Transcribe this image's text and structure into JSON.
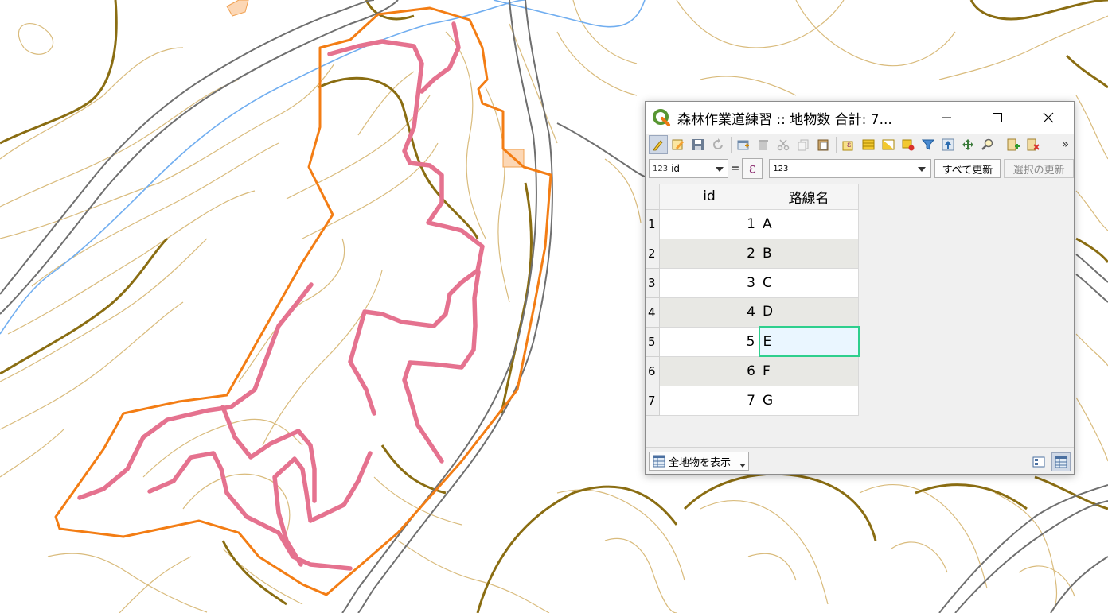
{
  "window": {
    "title": "森林作業道練習 :: 地物数 合計: 7...",
    "controls": [
      "minimize",
      "maximize",
      "close"
    ]
  },
  "colors": {
    "trail_line": "#e5728f",
    "boundary": "#f37d14",
    "contour_index": "#8a6d12",
    "contour": "#d9bb7c",
    "river": "#71aef0",
    "road": "#6f6f6f",
    "selection": "#2ecf8d"
  },
  "toolbar": {
    "icons": [
      "toggle-editing-icon",
      "multi-edit-icon",
      "save-edits-icon",
      "reload-icon",
      "add-feature-icon",
      "delete-feature-icon",
      "cut-icon",
      "copy-icon",
      "paste-icon",
      "select-by-expression-icon",
      "select-all-icon",
      "invert-selection-icon",
      "deselect-icon",
      "filter-icon",
      "move-selection-top-icon",
      "pan-to-selection-icon",
      "zoom-to-selection-icon",
      "new-field-icon",
      "delete-field-icon"
    ],
    "more": "»"
  },
  "filterbar": {
    "field_type": "123",
    "field_name": "id",
    "equals": "=",
    "expression_symbol": "ε",
    "value": "123",
    "update_all_label": "すべて更新",
    "update_selected_label": "選択の更新"
  },
  "table": {
    "columns": [
      "id",
      "路線名"
    ],
    "rows": [
      {
        "rownum": "1",
        "id": "1",
        "name": "A"
      },
      {
        "rownum": "2",
        "id": "2",
        "name": "B"
      },
      {
        "rownum": "3",
        "id": "3",
        "name": "C"
      },
      {
        "rownum": "4",
        "id": "4",
        "name": "D"
      },
      {
        "rownum": "5",
        "id": "5",
        "name": "E"
      },
      {
        "rownum": "6",
        "id": "6",
        "name": "F"
      },
      {
        "rownum": "7",
        "id": "7",
        "name": "G"
      }
    ],
    "selected_row_index": 4
  },
  "bottombar": {
    "show_all_label": "全地物を表示"
  }
}
